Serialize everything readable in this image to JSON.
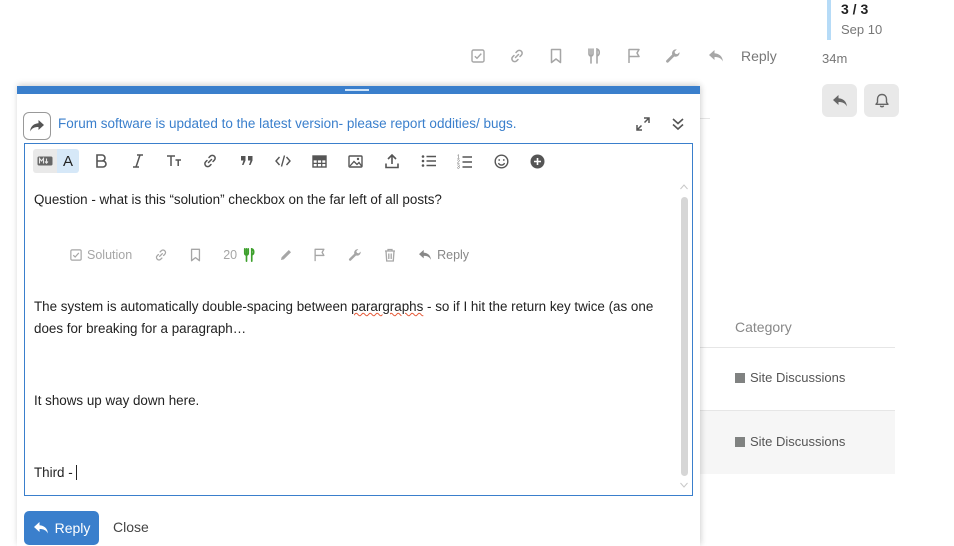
{
  "post_actions": {
    "icons": [
      "solution-checkbox-icon",
      "link-icon",
      "bookmark-icon",
      "fork-knife-icon",
      "flag-icon",
      "wrench-icon"
    ],
    "reply_label": "Reply"
  },
  "timeline": {
    "count": "3 / 3",
    "date": "Sep 10",
    "ago": "34m"
  },
  "table": {
    "category_header": "Category",
    "rows": [
      "Site Discussions",
      "Site Discussions"
    ]
  },
  "composer": {
    "topic_title": "Forum software is updated to the latest version- please report oddities/ bugs.",
    "toolbar_toggle_label": "A",
    "content": {
      "line1": "Question - what is this “solution” checkbox on the far left of all posts?",
      "para2_before": "The system is automatically double-spacing between ",
      "para2_misspelled": "parargraphs",
      "para2_after": " - so if I hit the return key twice (as one does for breaking for a paragraph…",
      "line3": "It shows up way down here.",
      "line4": "Third -"
    },
    "embedded_actions": {
      "solution_label": "Solution",
      "like_count": "20",
      "reply_label": "Reply"
    },
    "reply_button": "Reply",
    "close_label": "Close"
  },
  "colors": {
    "accent": "#3a7fcc",
    "like_green": "#3da02c",
    "category": "#808281"
  }
}
